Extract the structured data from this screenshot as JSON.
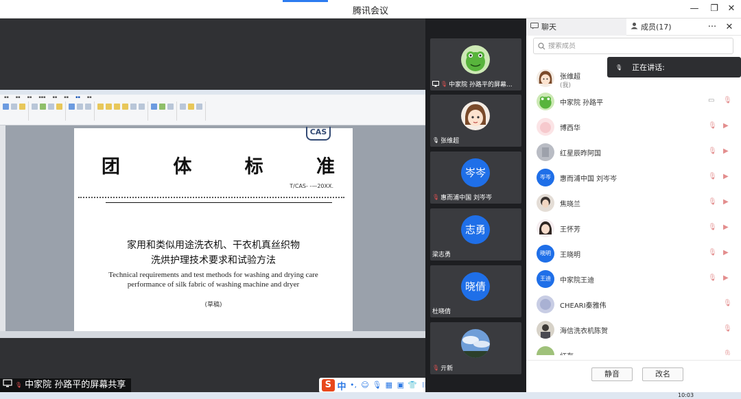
{
  "window": {
    "title": "腾讯会议",
    "minimize_glyph": "—",
    "restore_glyph": "❐",
    "close_glyph": "✕"
  },
  "document": {
    "logo": "CAS",
    "title_chars": [
      "团",
      "体",
      "标",
      "准"
    ],
    "code": "T/CAS- -—20XX.",
    "cn_title_line1": "家用和类似用途洗衣机、干衣机真丝织物",
    "cn_title_line2": "洗烘护理技术要求和试验方法",
    "en_title": "Technical requirements and test methods for washing and drying care performance of silk fabric of washing machine and dryer",
    "draft": "(草稿)"
  },
  "share_label": "中家院 孙路平的屏幕共享",
  "ime": {
    "logo": "S",
    "mode": "中"
  },
  "video_tiles": [
    {
      "name": "中家院 孙路平的屏幕...",
      "avatar": "frog-avatar",
      "avatar_text": "",
      "icon": "screen-share-icon"
    },
    {
      "name": "张维超",
      "avatar": "cartoon-girl-avatar",
      "avatar_text": "",
      "icon": "mic-icon"
    },
    {
      "name": "惠而浦中国 刘岑岑",
      "avatar": "text-avatar",
      "avatar_text": "岑岑",
      "icon": "mic-muted-icon"
    },
    {
      "name": "梁志勇",
      "avatar": "text-avatar",
      "avatar_text": "志勇",
      "icon": ""
    },
    {
      "name": "杜晓倩",
      "avatar": "text-avatar",
      "avatar_text": "晓倩",
      "icon": ""
    },
    {
      "name": "亓新",
      "avatar": "sky-photo-avatar",
      "avatar_text": "",
      "icon": "mic-muted-icon"
    }
  ],
  "panel": {
    "chat_tab": "聊天",
    "members_tab": "成员(17)",
    "search_placeholder": "搜索成员",
    "speaking_label": "正在讲话:",
    "mute_all_button": "静音",
    "rename_button": "改名"
  },
  "members": [
    {
      "name": "张维超",
      "sub": "(我)",
      "avatar": "cartoon-girl-avatar",
      "avatar_text": ""
    },
    {
      "name": "中家院 孙路平",
      "sub": "",
      "avatar": "frog-avatar",
      "avatar_text": ""
    },
    {
      "name": "博西华",
      "sub": "",
      "avatar": "pink-avatar",
      "avatar_text": ""
    },
    {
      "name": "红星辰昨阿国",
      "sub": "",
      "avatar": "gray-photo-avatar",
      "avatar_text": ""
    },
    {
      "name": "惠而浦中国 刘岑岑",
      "sub": "",
      "avatar": "text-avatar",
      "avatar_text": "岑岑"
    },
    {
      "name": "焦晓兰",
      "sub": "",
      "avatar": "dark-photo-avatar",
      "avatar_text": ""
    },
    {
      "name": "王怀芳",
      "sub": "",
      "avatar": "girl-photo-avatar",
      "avatar_text": ""
    },
    {
      "name": "王晓明",
      "sub": "",
      "avatar": "text-avatar",
      "avatar_text": "晓明"
    },
    {
      "name": "中家院王迪",
      "sub": "",
      "avatar": "text-avatar",
      "avatar_text": "王迪"
    },
    {
      "name": "CHEARI秦雅伟",
      "sub": "",
      "avatar": "blurred-photo-avatar",
      "avatar_text": ""
    },
    {
      "name": "海信洗衣机陈贺",
      "sub": "",
      "avatar": "person-photo-avatar",
      "avatar_text": ""
    },
    {
      "name": "红存",
      "sub": "",
      "avatar": "green-photo-avatar",
      "avatar_text": ""
    }
  ],
  "taskbar": {
    "clock": "10:03"
  }
}
